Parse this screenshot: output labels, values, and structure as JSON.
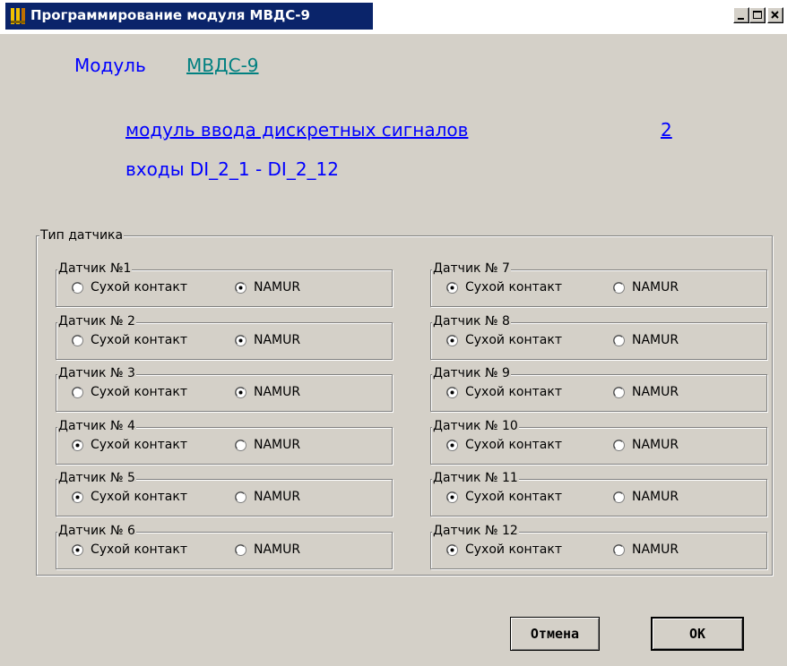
{
  "window": {
    "title": "Программирование модуля  МВДС-9"
  },
  "module": {
    "label": "Модуль",
    "name": "МВДС-9"
  },
  "description": {
    "text": "модуль  ввода дискретных сигналов",
    "number": "2",
    "inputs": "входы DI_2_1 - DI_2_12"
  },
  "sensor_group": {
    "label": "Тип датчика"
  },
  "sensors": [
    {
      "label": "Датчик №1",
      "opt1": "Сухой контакт",
      "opt2": "NAMUR",
      "selected": "NAMUR"
    },
    {
      "label": "Датчик № 2",
      "opt1": "Сухой контакт",
      "opt2": "NAMUR",
      "selected": "NAMUR"
    },
    {
      "label": "Датчик № 3",
      "opt1": "Сухой контакт",
      "opt2": "NAMUR",
      "selected": "NAMUR"
    },
    {
      "label": "Датчик № 4",
      "opt1": "Сухой контакт",
      "opt2": "NAMUR",
      "selected": "Сухой контакт"
    },
    {
      "label": "Датчик № 5",
      "opt1": "Сухой контакт",
      "opt2": "NAMUR",
      "selected": "Сухой контакт"
    },
    {
      "label": "Датчик № 6",
      "opt1": "Сухой контакт",
      "opt2": "NAMUR",
      "selected": "Сухой контакт"
    },
    {
      "label": "Датчик № 7",
      "opt1": "Сухой контакт",
      "opt2": "NAMUR",
      "selected": "Сухой контакт"
    },
    {
      "label": "Датчик № 8",
      "opt1": "Сухой контакт",
      "opt2": "NAMUR",
      "selected": "Сухой контакт"
    },
    {
      "label": "Датчик № 9",
      "opt1": "Сухой контакт",
      "opt2": "NAMUR",
      "selected": "Сухой контакт"
    },
    {
      "label": "Датчик № 10",
      "opt1": "Сухой контакт",
      "opt2": "NAMUR",
      "selected": "Сухой контакт"
    },
    {
      "label": "Датчик № 11",
      "opt1": "Сухой контакт",
      "opt2": "NAMUR",
      "selected": "Сухой контакт"
    },
    {
      "label": "Датчик № 12",
      "opt1": "Сухой контакт",
      "opt2": "NAMUR",
      "selected": "Сухой контакт"
    }
  ],
  "buttons": {
    "cancel": "Отмена",
    "ok": "OK"
  },
  "icons": {
    "app": "app-icon",
    "minimize": "minimize-icon",
    "maximize": "maximize-icon",
    "close": "close-icon"
  },
  "colors": {
    "title_bar": "#0a246a",
    "link_blue": "#0000ff",
    "module_name": "#008080",
    "window_bg": "#d4d0c8"
  }
}
